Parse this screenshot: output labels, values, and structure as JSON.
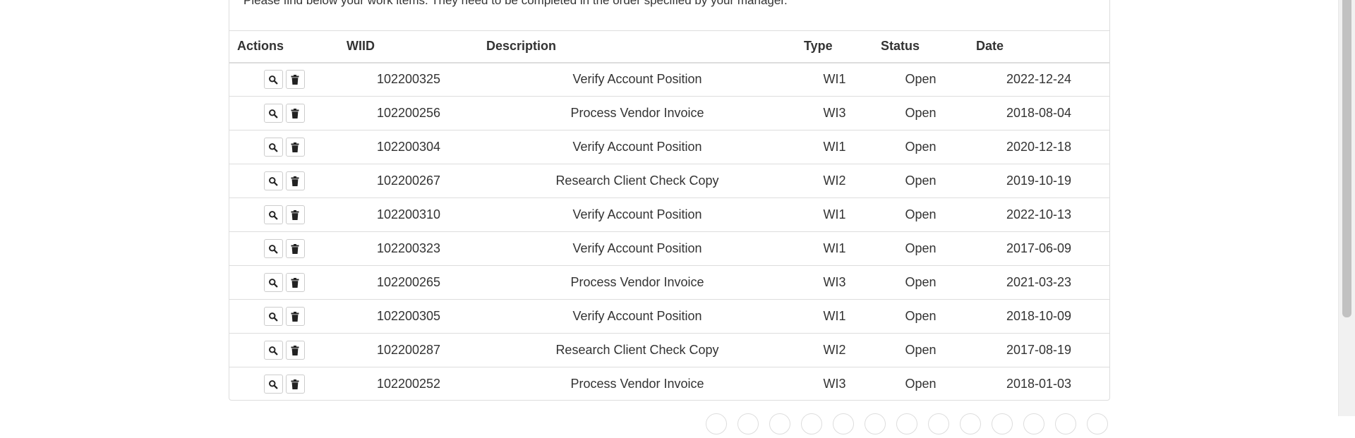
{
  "intro_text": "Please find below your work items. They need to be completed in the order specified by your manager.",
  "table": {
    "headers": {
      "actions": "Actions",
      "wiid": "WIID",
      "description": "Description",
      "type": "Type",
      "status": "Status",
      "date": "Date"
    },
    "rows": [
      {
        "wiid": "102200325",
        "description": "Verify Account Position",
        "type": "WI1",
        "status": "Open",
        "date": "2022-12-24"
      },
      {
        "wiid": "102200256",
        "description": "Process Vendor Invoice",
        "type": "WI3",
        "status": "Open",
        "date": "2018-08-04"
      },
      {
        "wiid": "102200304",
        "description": "Verify Account Position",
        "type": "WI1",
        "status": "Open",
        "date": "2020-12-18"
      },
      {
        "wiid": "102200267",
        "description": "Research Client Check Copy",
        "type": "WI2",
        "status": "Open",
        "date": "2019-10-19"
      },
      {
        "wiid": "102200310",
        "description": "Verify Account Position",
        "type": "WI1",
        "status": "Open",
        "date": "2022-10-13"
      },
      {
        "wiid": "102200323",
        "description": "Verify Account Position",
        "type": "WI1",
        "status": "Open",
        "date": "2017-06-09"
      },
      {
        "wiid": "102200265",
        "description": "Process Vendor Invoice",
        "type": "WI3",
        "status": "Open",
        "date": "2021-03-23"
      },
      {
        "wiid": "102200305",
        "description": "Verify Account Position",
        "type": "WI1",
        "status": "Open",
        "date": "2018-10-09"
      },
      {
        "wiid": "102200287",
        "description": "Research Client Check Copy",
        "type": "WI2",
        "status": "Open",
        "date": "2017-08-19"
      },
      {
        "wiid": "102200252",
        "description": "Process Vendor Invoice",
        "type": "WI3",
        "status": "Open",
        "date": "2018-01-03"
      }
    ],
    "row_actions": [
      "search-icon",
      "trash-icon"
    ]
  },
  "pagination": {
    "visible_buttons": 13
  }
}
